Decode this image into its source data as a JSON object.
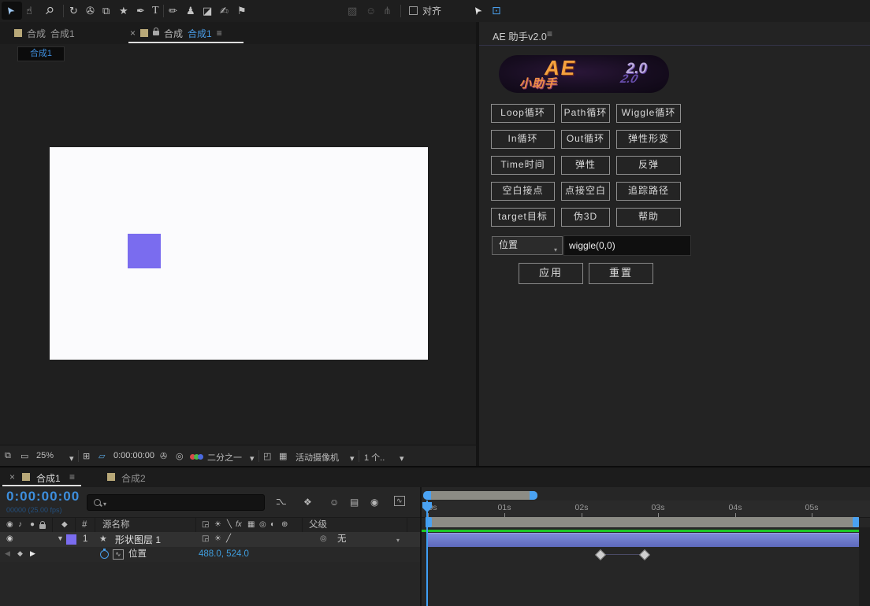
{
  "toolbar": {
    "tools": [
      {
        "name": "selection-tool",
        "glyph": "➤"
      },
      {
        "name": "hand-tool",
        "glyph": "☝"
      },
      {
        "name": "zoom-tool",
        "glyph": "⚲"
      },
      {
        "name": "rotation-tool",
        "glyph": "↻"
      },
      {
        "name": "camera-tool",
        "glyph": "✇"
      },
      {
        "name": "pan-behind-tool",
        "glyph": "⧉"
      },
      {
        "name": "shape-tool",
        "glyph": "★"
      },
      {
        "name": "pen-tool",
        "glyph": "✒"
      },
      {
        "name": "text-tool",
        "glyph": "T"
      },
      {
        "name": "brush-tool",
        "glyph": "✏"
      },
      {
        "name": "clone-stamp-tool",
        "glyph": "♟"
      },
      {
        "name": "eraser-tool",
        "glyph": "◪"
      },
      {
        "name": "roto-brush-tool",
        "glyph": "✍"
      },
      {
        "name": "puppet-pin-tool",
        "glyph": "⚑"
      }
    ],
    "dimmed_tools": [
      {
        "name": "fill-tool",
        "glyph": "▨"
      },
      {
        "name": "puppet-overlap-tool",
        "glyph": "☺"
      },
      {
        "name": "bone-tool",
        "glyph": "⋔"
      }
    ],
    "align_label": "对齐",
    "cursor_icon": "➤",
    "workspace_icon": "⊡"
  },
  "viewer": {
    "tab1": {
      "prefix": "合成",
      "name": "合成1"
    },
    "tab2": {
      "close": "×",
      "prefix": "合成",
      "name": "合成1",
      "menu": "≡"
    },
    "breadcrumb": "合成1",
    "controls": {
      "zoom": "25%",
      "timecode": "0:00:00:00",
      "resolution": "二分之一",
      "camera": "活动摄像机",
      "views": "1 个..",
      "icons": {
        "multi_view": "⧉",
        "monitor": "▭",
        "grid_options": "⊞",
        "mask_visibility": "▱",
        "snapshot": "✇",
        "show_snapshot": "◎",
        "roi": "◰",
        "transparency_grid": "▦"
      }
    }
  },
  "assistant": {
    "title": "AE 助手v2.0",
    "menu": "≡",
    "banner": {
      "line1": "AE",
      "line2": "小助手",
      "version": "2.0"
    },
    "buttons": [
      "Loop循环",
      "Path循环",
      "Wiggle循环",
      "In循环",
      "Out循环",
      "弹性形变",
      "Time时间",
      "弹性",
      "反弹",
      "空白接点",
      "点接空白",
      "追踪路径",
      "target目标",
      "伪3D",
      "帮助"
    ],
    "property_select": "位置",
    "expression": "wiggle(0,0)",
    "apply_label": "应用",
    "reset_label": "重置"
  },
  "timeline": {
    "tab1": {
      "close": "×",
      "name": "合成1",
      "menu": "≡"
    },
    "tab2": {
      "name": "合成2"
    },
    "timecode": "0:00:00:00",
    "frame_info": "00000 (25.00 fps)",
    "toolbar_icons": {
      "mini_flowchart": "⌥",
      "draft_3d": "❖",
      "shy": "☺",
      "frame_blend": "▤",
      "motion_blur": "◉",
      "graph_editor": "∿"
    },
    "columns": {
      "number": "#",
      "source_name": "源名称",
      "parent": "父级"
    },
    "switch_icons": [
      "◲",
      "☀",
      "╲",
      "fx",
      "▦",
      "◎",
      "◐",
      "⊕"
    ],
    "layer": {
      "index": "1",
      "star": "★",
      "name": "形状图层 1",
      "parent_value": "无",
      "switch1": "◲",
      "switch2": "☀",
      "switch3": "╱"
    },
    "property": {
      "name": "位置",
      "value": "488.0, 524.0"
    },
    "ruler_labels": [
      "0s",
      "01s",
      "02s",
      "03s",
      "04s",
      "05s"
    ]
  },
  "colors": {
    "accent_blue": "#3f8edd",
    "layer_purple": "#7a6cef",
    "cache_green": "#1cc823",
    "bar_gray": "#8c8c85",
    "workarea_cap": "#4aa2f2"
  }
}
